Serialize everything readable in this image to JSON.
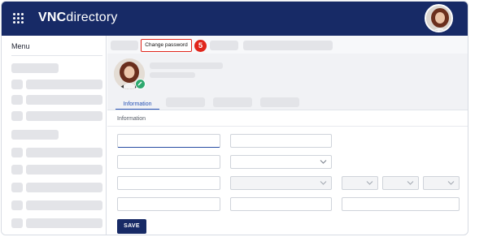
{
  "app": {
    "brand_bold": "VNC",
    "brand_rest": "directory"
  },
  "sidebar": {
    "title": "Menu"
  },
  "toolbar": {
    "change_password_label": "Change password",
    "step_number": "5"
  },
  "profile": {
    "tabs": [
      {
        "label": "Information",
        "active": true
      }
    ]
  },
  "form": {
    "section_label": "Information",
    "save_label": "SAVE"
  },
  "colors": {
    "navbar": "#172a66",
    "accent": "#2551b5",
    "highlight": "#e0251b",
    "edit_badge": "#2ea96f"
  },
  "icons": {
    "apps": "apps-grid-icon",
    "edit": "pencil-icon",
    "dropdown": "chevron-down-icon"
  }
}
